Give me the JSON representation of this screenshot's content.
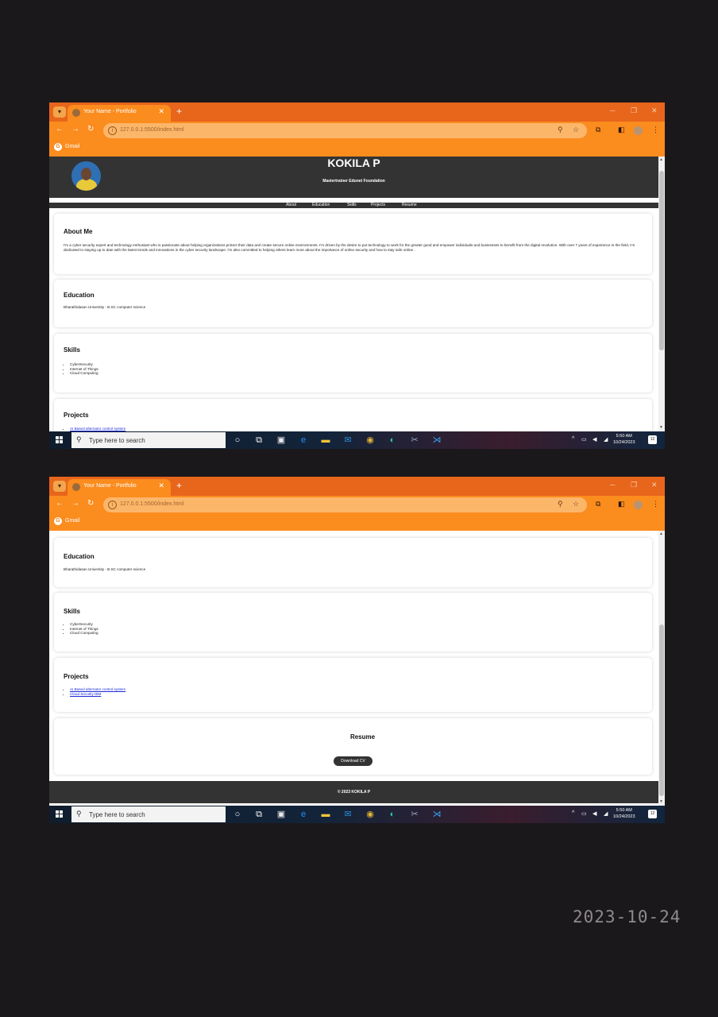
{
  "browser": {
    "tab_title": "Your Name - Portfolio",
    "url": "127.0.0.1:5500/index.html",
    "bookmark": "Gmail"
  },
  "site": {
    "name": "KOKILA P",
    "subtitle": "Mastertrainer Edunet Foundation",
    "nav": [
      "About",
      "Education",
      "Skills",
      "Projects",
      "Resume"
    ],
    "about": {
      "title": "About Me",
      "text": "I'm a cyber security expert and technology enthusiast who is passionate about helping organizations protect their data and create secure online environments. I'm driven by the desire to put technology to work for the greater good and empower individuals and businesses to benefit from the digital revolution. With over 7 years of experience in the field, I'm dedicated to staying up to date with the latest trends and innovations in the cyber security landscape. I'm also committed to helping others learn more about the importance of online security and how to stay safe online ."
    },
    "education": {
      "title": "Education",
      "text": "Bharathidasan University - B.SC computer science"
    },
    "skills": {
      "title": "Skills",
      "items": [
        "CyberSecurity",
        "Internet of Things",
        "Cloud Computing"
      ]
    },
    "projects": {
      "title": "Projects",
      "items": [
        "AI Based alternator control system",
        "Cloud Security IBM"
      ]
    },
    "resume": {
      "title": "Resume",
      "button": "Download CV"
    },
    "footer": "© 2023 KOKILA P"
  },
  "taskbar": {
    "search_placeholder": "Type here to search",
    "time": "5:50 AM",
    "date": "10/24/2023",
    "notifications": "12"
  },
  "photo_date_stamp": "2023-10-24"
}
